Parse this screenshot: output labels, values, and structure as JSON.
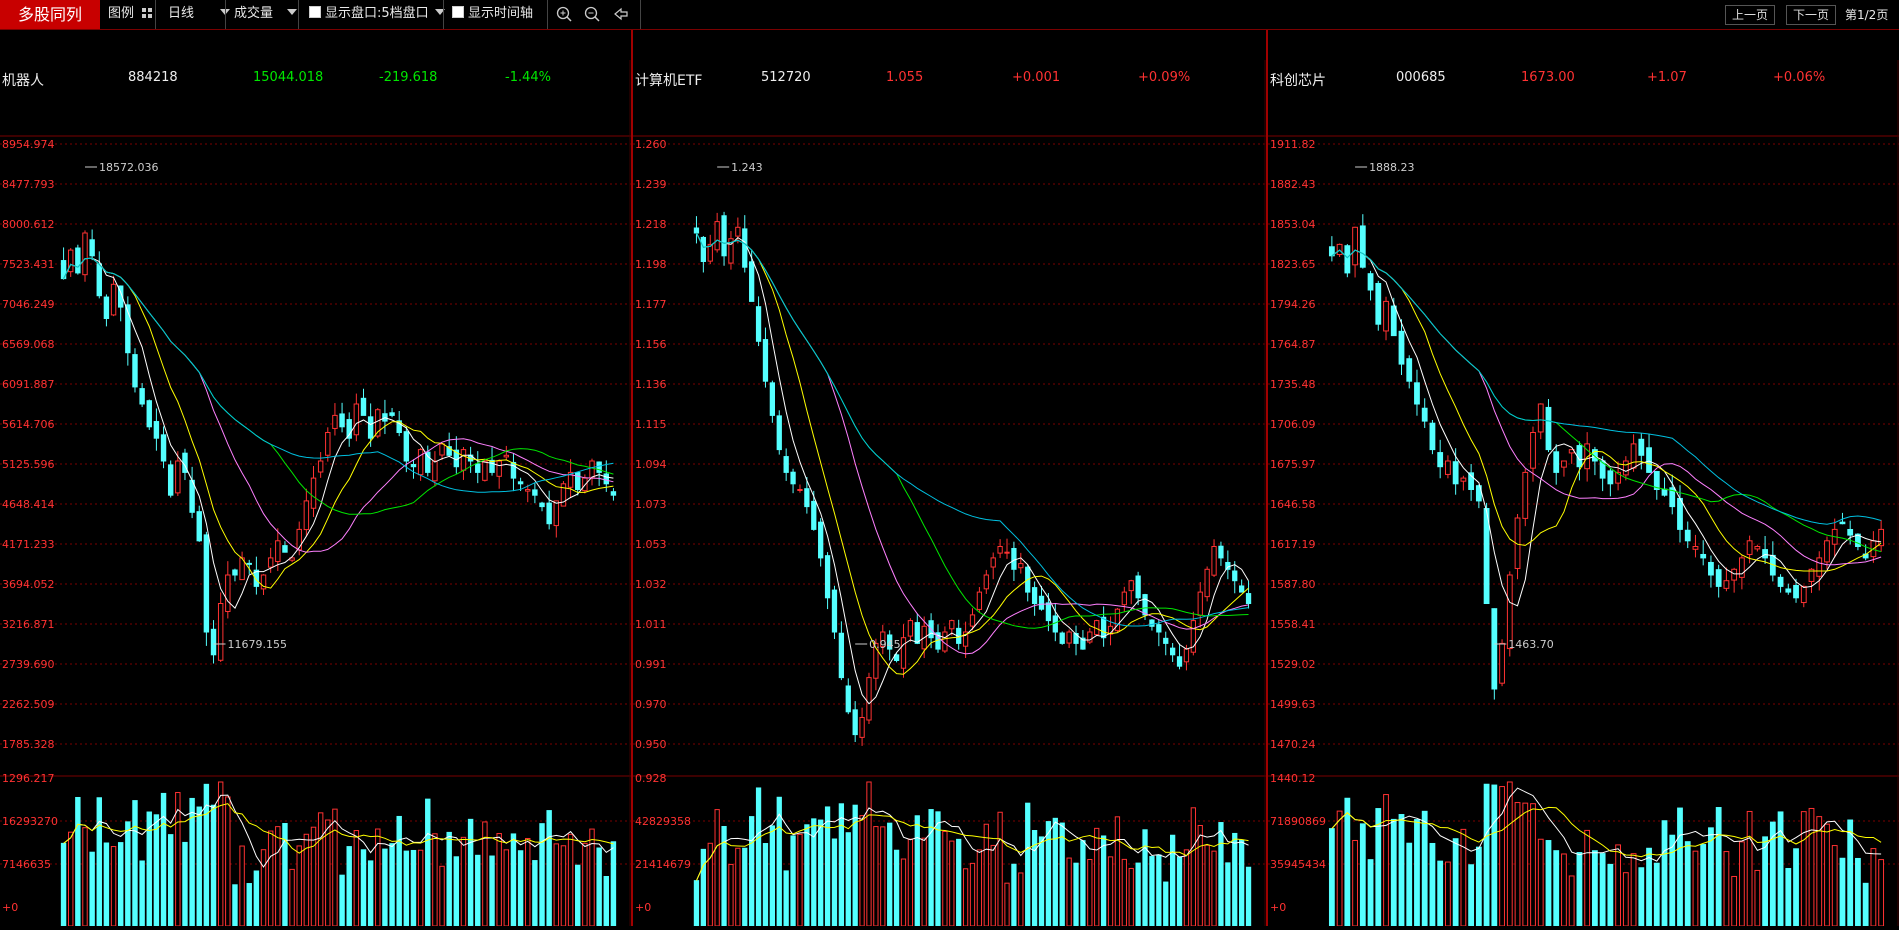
{
  "toolbar": {
    "title": "多股同列",
    "legend_label": "图例",
    "period": "日线",
    "indicator": "成交量",
    "show_quote_label": "显示盘口:5档盘口",
    "show_time_axis_label": "显示时间轴",
    "prev_page": "上一页",
    "next_page": "下一页",
    "page_indicator": "第1/2页"
  },
  "colors": {
    "up": "#ff3232",
    "down": "#54ffff",
    "grid": "#7a0000",
    "axis_text": "#ff3232",
    "ma5": "#ffffff",
    "ma10": "#ffff00",
    "ma20": "#ff80ff",
    "ma60": "#00e600",
    "ma120": "#00c0e0"
  },
  "panels": [
    {
      "name": "机器人",
      "code": "884218",
      "price": "15044.018",
      "change": "-219.618",
      "pct": "-1.44%",
      "quote_color": "#00e600",
      "price_ticks": [
        "8954.974",
        "8477.793",
        "8000.612",
        "7523.431",
        "7046.249",
        "6569.068",
        "6091.887",
        "5614.706",
        "5125.596",
        "4648.414",
        "4171.233",
        "3694.052",
        "3216.871",
        "2739.690",
        "2262.509",
        "1785.328"
      ],
      "vol_ticks": [
        "1296.217",
        "16293270",
        "7146635",
        "+0"
      ],
      "high_label": "18572.036",
      "low_label": "11679.155",
      "chart_data": {
        "type": "candlestick",
        "close": [
          0.82,
          0.87,
          0.83,
          0.9,
          0.86,
          0.79,
          0.75,
          0.81,
          0.77,
          0.69,
          0.63,
          0.6,
          0.56,
          0.54,
          0.5,
          0.44,
          0.5,
          0.48,
          0.41,
          0.36,
          0.2,
          0.16,
          0.25,
          0.3,
          0.3,
          0.33,
          0.32,
          0.28,
          0.3,
          0.33,
          0.36,
          0.34,
          0.33,
          0.38,
          0.43,
          0.47,
          0.5,
          0.55,
          0.58,
          0.56,
          0.54,
          0.6,
          0.58,
          0.54,
          0.59,
          0.57,
          0.58,
          0.55,
          0.5,
          0.49,
          0.52,
          0.48,
          0.5,
          0.53,
          0.51,
          0.49,
          0.52,
          0.5,
          0.48,
          0.5,
          0.48,
          0.5,
          0.51,
          0.47,
          0.46,
          0.45,
          0.44,
          0.42,
          0.39,
          0.43,
          0.46,
          0.48,
          0.45,
          0.47,
          0.5,
          0.48,
          0.46,
          0.44
        ]
      }
    },
    {
      "name": "计算机ETF",
      "code": "512720",
      "price": "1.055",
      "change": "+0.001",
      "pct": "+0.09%",
      "quote_color": "#ff3232",
      "price_ticks": [
        "1.260",
        "1.239",
        "1.218",
        "1.198",
        "1.177",
        "1.156",
        "1.136",
        "1.115",
        "1.094",
        "1.073",
        "1.053",
        "1.032",
        "1.011",
        "0.991",
        "0.970",
        "0.950"
      ],
      "vol_ticks": [
        "0.928",
        "42829358",
        "21414679",
        "+0"
      ],
      "high_label": "1.243",
      "low_label": "0.945",
      "chart_data": {
        "type": "candlestick",
        "close": [
          0.9,
          0.85,
          0.88,
          0.92,
          0.86,
          0.89,
          0.91,
          0.84,
          0.78,
          0.71,
          0.64,
          0.58,
          0.52,
          0.48,
          0.46,
          0.45,
          0.42,
          0.38,
          0.33,
          0.26,
          0.2,
          0.12,
          0.06,
          0.02,
          0.05,
          0.12,
          0.18,
          0.2,
          0.17,
          0.15,
          0.19,
          0.22,
          0.18,
          0.21,
          0.19,
          0.17,
          0.2,
          0.22,
          0.18,
          0.2,
          0.23,
          0.27,
          0.3,
          0.33,
          0.35,
          0.34,
          0.31,
          0.32,
          0.27,
          0.25,
          0.24,
          0.22,
          0.2,
          0.18,
          0.2,
          0.18,
          0.17,
          0.2,
          0.22,
          0.19,
          0.21,
          0.24,
          0.27,
          0.29,
          0.26,
          0.23,
          0.21,
          0.2,
          0.18,
          0.16,
          0.14,
          0.17,
          0.22,
          0.27,
          0.31,
          0.35,
          0.33,
          0.31,
          0.29,
          0.27,
          0.25
        ]
      }
    },
    {
      "name": "科创芯片",
      "code": "000685",
      "price": "1673.00",
      "change": "+1.07",
      "pct": "+0.06%",
      "quote_color": "#ff3232",
      "price_ticks": [
        "1911.82",
        "1882.43",
        "1853.04",
        "1823.65",
        "1794.26",
        "1764.87",
        "1735.48",
        "1706.09",
        "1675.97",
        "1646.58",
        "1617.19",
        "1587.80",
        "1558.41",
        "1529.02",
        "1499.63",
        "1470.24"
      ],
      "vol_ticks": [
        "1440.12",
        "71890869",
        "35945434",
        "+0"
      ],
      "high_label": "1888.23",
      "low_label": "1463.70",
      "chart_data": {
        "type": "candlestick",
        "close": [
          0.86,
          0.88,
          0.83,
          0.91,
          0.84,
          0.8,
          0.74,
          0.78,
          0.72,
          0.67,
          0.64,
          0.6,
          0.57,
          0.52,
          0.49,
          0.5,
          0.46,
          0.47,
          0.45,
          0.43,
          0.25,
          0.1,
          0.18,
          0.3,
          0.4,
          0.48,
          0.55,
          0.6,
          0.52,
          0.48,
          0.5,
          0.52,
          0.49,
          0.53,
          0.5,
          0.47,
          0.46,
          0.48,
          0.5,
          0.53,
          0.51,
          0.48,
          0.45,
          0.44,
          0.42,
          0.38,
          0.36,
          0.35,
          0.33,
          0.3,
          0.28,
          0.29,
          0.31,
          0.33,
          0.36,
          0.35,
          0.33,
          0.3,
          0.28,
          0.27,
          0.26,
          0.28,
          0.31,
          0.33,
          0.36,
          0.38,
          0.39,
          0.37,
          0.35,
          0.33,
          0.36,
          0.38
        ]
      }
    }
  ]
}
